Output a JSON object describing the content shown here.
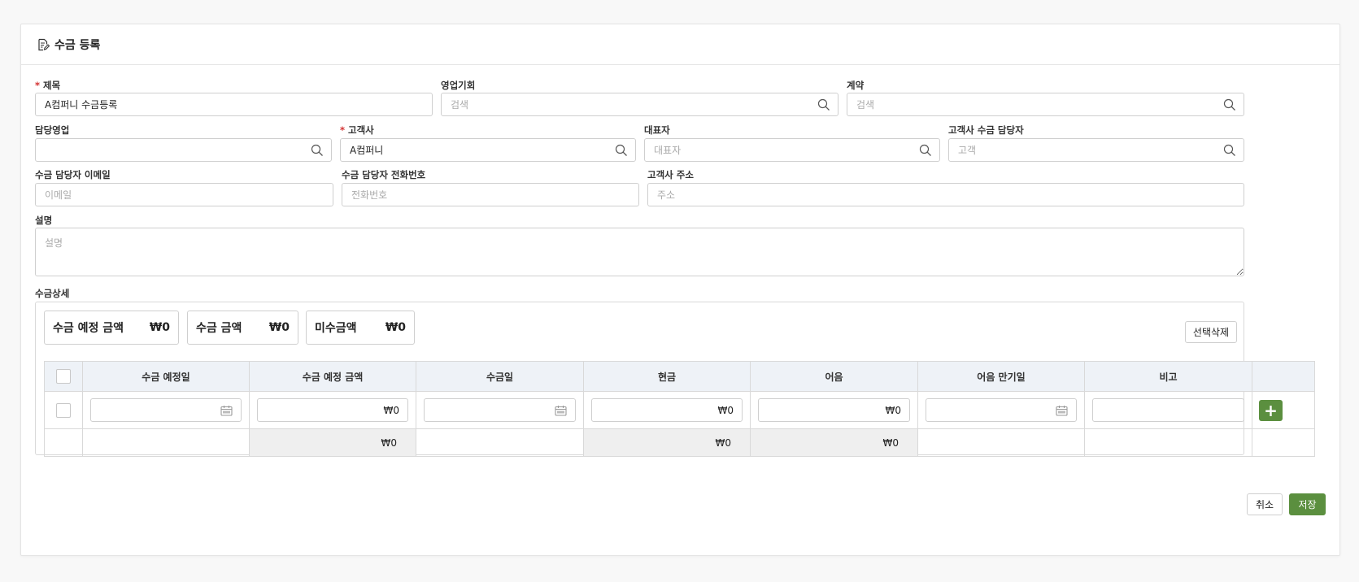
{
  "header": {
    "title": "수금 등록"
  },
  "form": {
    "title": {
      "label": "제목",
      "value": "A컴퍼니 수금등록"
    },
    "opportunity": {
      "label": "영업기회",
      "placeholder": "검색"
    },
    "contract": {
      "label": "계약",
      "placeholder": "검색"
    },
    "sales_rep": {
      "label": "담당영업",
      "value": ""
    },
    "customer": {
      "label": "고객사",
      "value": "A컴퍼니"
    },
    "ceo": {
      "label": "대표자",
      "placeholder": "대표자"
    },
    "customer_contact": {
      "label": "고객사 수금 담당자",
      "placeholder": "고객"
    },
    "contact_email": {
      "label": "수금 담당자 이메일",
      "placeholder": "이메일"
    },
    "contact_phone": {
      "label": "수금 담당자 전화번호",
      "placeholder": "전화번호"
    },
    "customer_address": {
      "label": "고객사 주소",
      "placeholder": "주소"
    },
    "description": {
      "label": "설명",
      "placeholder": "설명"
    },
    "required_mark": "*"
  },
  "details": {
    "label": "수금상세",
    "summary": [
      {
        "label": "수금 예정 금액",
        "value": "₩0"
      },
      {
        "label": "수금 금액",
        "value": "₩0"
      },
      {
        "label": "미수금액",
        "value": "₩0"
      }
    ],
    "delete_selected": "선택삭제",
    "columns": [
      "수금 예정일",
      "수금 예정 금액",
      "수금일",
      "현금",
      "어음",
      "어음 만기일",
      "비고"
    ],
    "row": {
      "planned_amount": "₩0",
      "cash": "₩0",
      "note_amount": "₩0"
    },
    "totals": {
      "planned_amount": "₩0",
      "cash": "₩0",
      "note_amount": "₩0"
    },
    "add_label": "+"
  },
  "footer": {
    "cancel": "취소",
    "save": "저장"
  },
  "colors": {
    "accent": "#5b8f3f",
    "required": "#d32f2f",
    "table_header": "#eef2f7"
  }
}
